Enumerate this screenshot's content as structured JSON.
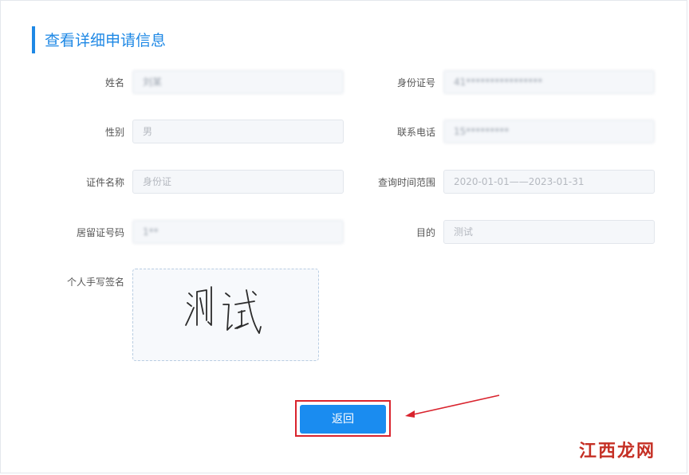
{
  "page": {
    "title": "查看详细申请信息"
  },
  "fields": [
    {
      "label": "姓名",
      "value": "刘某"
    },
    {
      "label": "身份证号",
      "value": "41****************"
    },
    {
      "label": "性别",
      "value": "男"
    },
    {
      "label": "联系电话",
      "value": "15*********"
    },
    {
      "label": "证件名称",
      "value": "身份证"
    },
    {
      "label": "查询时间范围",
      "value": "2020-01-01——2023-01-31"
    },
    {
      "label": "居留证号码",
      "value": "1**"
    },
    {
      "label": "目的",
      "value": "测试"
    }
  ],
  "signature": {
    "label": "个人手写签名",
    "handwriting": "测试"
  },
  "actions": {
    "back_label": "返回"
  },
  "watermark": "江西龙网",
  "colors": {
    "accent": "#1e88e5",
    "button": "#1a8cf0",
    "highlight": "#d9232d"
  }
}
